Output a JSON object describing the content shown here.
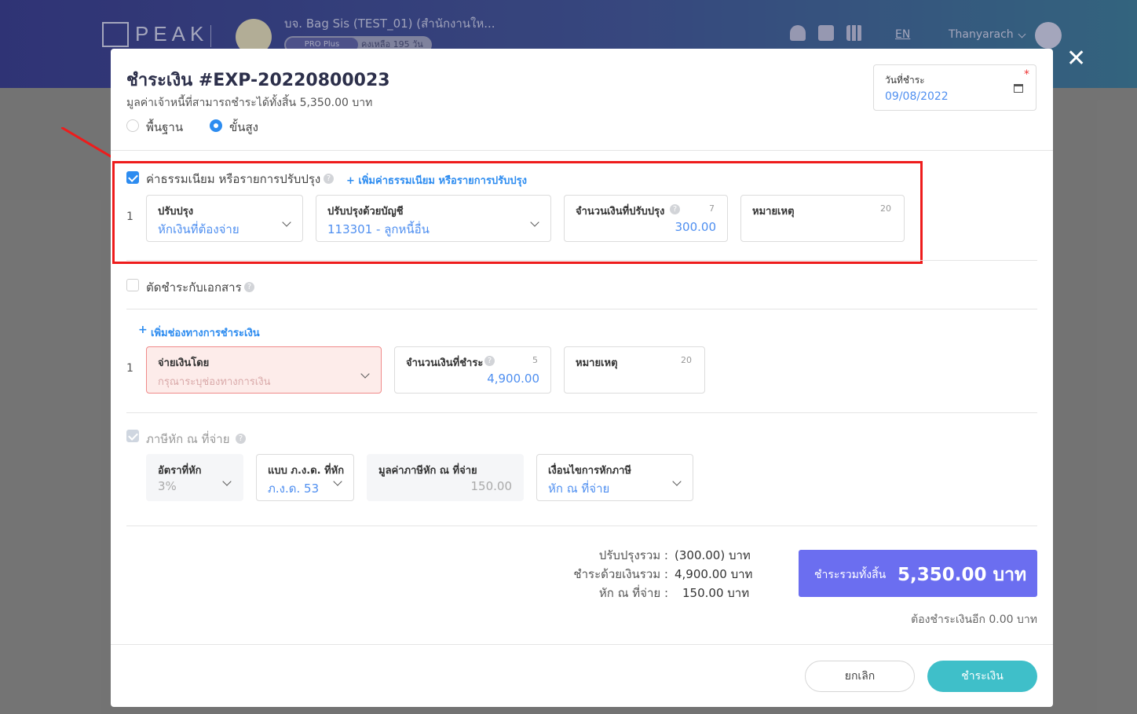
{
  "topbar": {
    "logo": "PEAK",
    "company": "บจ. Bag Sis (TEST_01) (สำนักงานให...",
    "plan": "PRO Plus",
    "remaining": "คงเหลือ 195 วัน",
    "lang": "EN",
    "user": "Thanyarach"
  },
  "modal": {
    "title": "ชำระเงิน #EXP-20220800023",
    "subtitle": "มูลค่าเจ้าหนี้ที่สามารถชำระได้ทั้งสิ้น 5,350.00 บาท",
    "mode_basic": "พื้นฐาน",
    "mode_advanced": "ขั้นสูง",
    "date_label": "วันที่ชำระ",
    "date_value": "09/08/2022"
  },
  "adjustment": {
    "label": "ค่าธรรมเนียม หรือรายการปรับปรุง",
    "add_link": "+ เพิ่มค่าธรรมเนียม หรือรายการปรับปรุง",
    "row_no": "1",
    "type_label": "ปรับปรุง",
    "type_value": "หักเงินที่ต้องจ่าย",
    "account_label": "ปรับปรุงด้วยบัญชี",
    "account_value": "113301 - ลูกหนี้อื่น",
    "amount_label": "จำนวนเงินที่ปรับปรุง",
    "amount_count": "7",
    "amount_value": "300.00",
    "note_label": "หมายเหตุ",
    "note_count": "20"
  },
  "offset": {
    "label": "ตัดชำระกับเอกสาร"
  },
  "payment": {
    "add_link": "เพิ่มช่องทางการชำระเงิน",
    "row_no": "1",
    "method_label": "จ่ายเงินโดย",
    "method_placeholder": "กรุณาระบุช่องทางการเงิน",
    "amount_label": "จำนวนเงินที่ชำระ",
    "amount_count": "5",
    "amount_value": "4,900.00",
    "note_label": "หมายเหตุ",
    "note_count": "20"
  },
  "wht": {
    "label": "ภาษีหัก ณ ที่จ่าย",
    "rate_label": "อัตราที่หัก",
    "rate_value": "3%",
    "form_label": "แบบ ภ.ง.ด. ที่หัก",
    "form_value": "ภ.ง.ด. 53",
    "value_label": "มูลค่าภาษีหัก ณ ที่จ่าย",
    "value_value": "150.00",
    "cond_label": "เงื่อนไขการหักภาษี",
    "cond_value": "หัก ณ ที่จ่าย"
  },
  "summary": {
    "adj_label": "ปรับปรุงรวม :",
    "adj_value": "(300.00) บาท",
    "paid_label": "ชำระด้วยเงินรวม :",
    "paid_value": "4,900.00 บาท",
    "wht_label": "หัก ณ ที่จ่าย :",
    "wht_value": "150.00 บาท",
    "total_label": "ชำระรวมทั้งสิ้น",
    "total_value": "5,350.00 บาท",
    "remaining": "ต้องชำระเงินอีก 0.00 บาท"
  },
  "actions": {
    "cancel": "ยกเลิก",
    "pay": "ชำระเงิน"
  },
  "colors": {
    "accent": "#2d8cf0",
    "total_bg": "#6b6ef0",
    "pay_bg": "#3fbfc9",
    "highlight": "#ee1c1c"
  }
}
